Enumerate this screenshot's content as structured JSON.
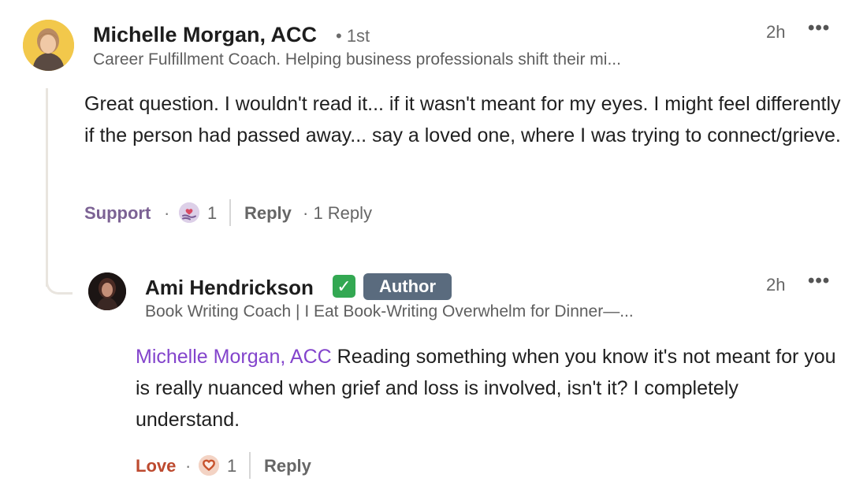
{
  "comment": {
    "author_name": "Michelle Morgan, ACC",
    "connection_degree": "• 1st",
    "headline": "Career Fulfillment Coach. Helping business professionals shift their mi...",
    "timestamp": "2h",
    "more_menu": "•••",
    "text": "Great question. I wouldn't read it... if it wasn't meant for my eyes. I might feel differently if the person had passed away... say a loved one, where I was trying to connect/grieve.",
    "reaction_label": "Support",
    "reaction_separator": "·",
    "reaction_icon": "support-reaction-icon",
    "reaction_count": "1",
    "reply_label": "Reply",
    "reply_count_text": "· 1 Reply"
  },
  "reply": {
    "author_name": "Ami Hendrickson",
    "verified_icon": "verified-check-icon",
    "verified_glyph": "✓",
    "author_badge": "Author",
    "headline": "Book Writing Coach | I Eat Book-Writing Overwhelm for Dinner—...",
    "timestamp": "2h",
    "more_menu": "•••",
    "mention": "Michelle Morgan, ACC",
    "text": "Reading something when you know it's not meant for you is really nuanced when grief and loss is involved, isn't it? I completely understand.",
    "reaction_label": "Love",
    "reaction_separator": "·",
    "reaction_icon": "love-reaction-icon",
    "reaction_count": "1",
    "reply_label": "Reply"
  },
  "colors": {
    "mention": "#8344cc",
    "support": "#7c6294",
    "love": "#bd4a2f",
    "author_badge_bg": "#5a6b7e",
    "verified_bg": "#33a852",
    "thread_line": "#e9e5df"
  }
}
